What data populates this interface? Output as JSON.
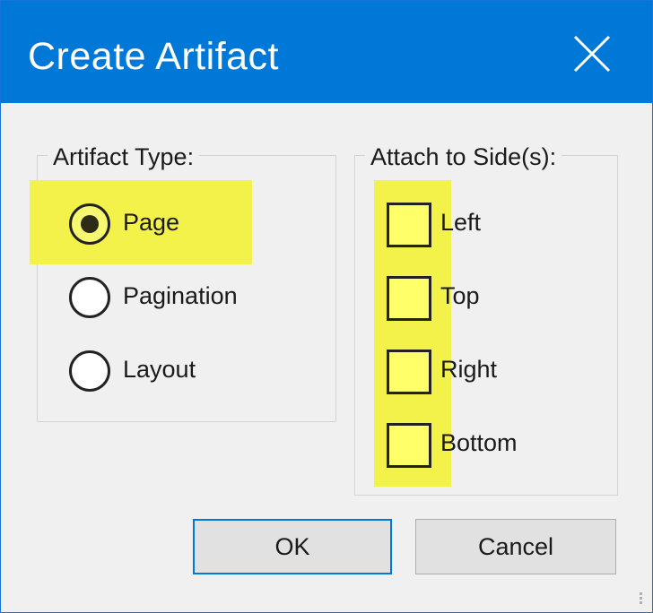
{
  "dialog": {
    "title": "Create Artifact",
    "close_icon": "close-icon",
    "accent_color": "#0078d7",
    "highlight_color": "#f2f24a"
  },
  "artifact_type": {
    "legend": "Artifact Type:",
    "selected": "Page",
    "options": [
      {
        "label": "Page",
        "checked": true
      },
      {
        "label": "Pagination",
        "checked": false
      },
      {
        "label": "Layout",
        "checked": false
      }
    ]
  },
  "attach_sides": {
    "legend": "Attach to Side(s):",
    "options": [
      {
        "label": "Left",
        "checked": false
      },
      {
        "label": "Top",
        "checked": false
      },
      {
        "label": "Right",
        "checked": false
      },
      {
        "label": "Bottom",
        "checked": false
      }
    ]
  },
  "buttons": {
    "ok_label": "OK",
    "cancel_label": "Cancel"
  }
}
